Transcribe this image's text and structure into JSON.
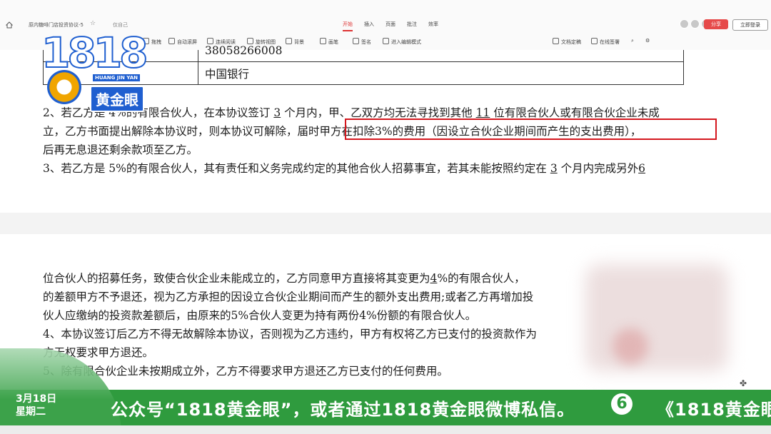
{
  "app": {
    "doc_title": "原内糖啡门店投资协议-5",
    "saved_status": "仅自己",
    "menu": [
      "开始",
      "插入",
      "页面",
      "批注",
      "效率"
    ],
    "active_menu": "开始",
    "share_label": "分享",
    "login_label": "立即登录"
  },
  "toolbar": {
    "items": [
      "拖拽",
      "自动滚屏",
      "连续阅读",
      "旋转视图",
      "背景",
      "画笔",
      "签名",
      "进入编辑模式",
      "文档定稿",
      "在线签署"
    ]
  },
  "document": {
    "table": {
      "row1_value": "38058266008",
      "row2_value": "中国银行"
    },
    "para2": {
      "line1_a": "2、若乙方是 4%的有限合伙人，在本协议签订",
      "line1_u1": "3",
      "line1_b": "个月内，甲、乙双方均无法寻找到其他",
      "line1_u2": "11",
      "line1_c": "位有限合伙人或有限合伙企业未成",
      "line2_a": "立，乙方书面提出解除本协议时，则本协议可解除，届时",
      "line2_b": "甲方在扣除3%的费用（因设立合伙企业期间而产生的支出费用），",
      "line3": "后再无息退还剩余款项至乙方。"
    },
    "para3": {
      "line1_a": "3、若乙方是 5%的有限合伙人，其有责任和义务完成约定的其他合伙人招募事宜，若其未能按照约定在",
      "line1_u1": "3",
      "line1_b": "个月内完成另外",
      "line1_u2": "6"
    },
    "page2": {
      "line1_a": "位合伙人的招募任务，致使合伙企业未能成立的，乙方同意甲方直接将其变更为",
      "line1_u": "4",
      "line1_b": "%的有限合伙人，",
      "line2": "的差额甲方不予退还，视为乙方承担的因设立合伙企业期间而产生的额外支出费用;或者乙方再增加投",
      "line3": "伙人应缴纳的投资款差额后，由原来的5%合伙人变更为持有两份4%份额的有限合伙人。",
      "line4": "4、本协议签订后乙方不得无故解除本协议，否则视为乙方违约，甲方有权将乙方已支付的投资款作为",
      "line5": "方无权要求甲方退还。",
      "line6": "5、除有限合伙企业未按期成立外，乙方不得要求甲方退还乙方已支付的任何费用。"
    }
  },
  "overlay": {
    "logo_number": "1818",
    "logo_pinyin": "HUANG JIN YAN",
    "logo_brand": "黄金眼",
    "date": "3月18日",
    "weekday": "星期二",
    "ticker": "公众号“1818黄金眼”，或者通过1818黄金眼微博私信。",
    "ticker_tail": "《1818黄金眼",
    "channel_number": "6"
  }
}
